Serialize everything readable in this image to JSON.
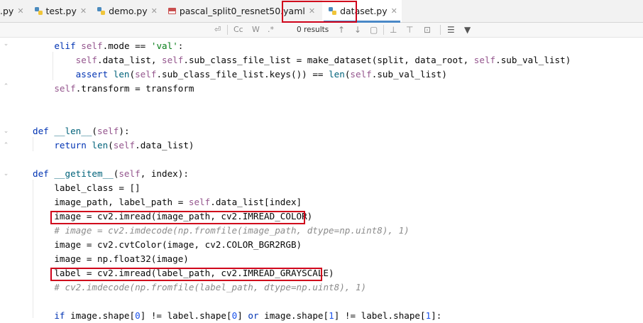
{
  "tabs": [
    {
      "label": ".py",
      "icon": "python-file-icon",
      "active": false
    },
    {
      "label": "test.py",
      "icon": "python-file-icon",
      "active": false
    },
    {
      "label": "demo.py",
      "icon": "python-file-icon",
      "active": false
    },
    {
      "label": "pascal_split0_resnet50.yaml",
      "icon": "yaml-file-icon",
      "active": false
    },
    {
      "label": "dataset.py",
      "icon": "python-file-icon",
      "active": true
    }
  ],
  "search": {
    "match_case": "Cc",
    "words": "W",
    "regex": ".*",
    "results": "0 results"
  },
  "code_lines": [
    "    elif self.mode == 'val':",
    "        self.data_list, self.sub_class_file_list = make_dataset(split, data_root, self.sub_val_list)",
    "        assert len(self.sub_class_file_list.keys()) == len(self.sub_val_list)",
    "    self.transform = transform",
    "",
    "",
    "def __len__(self):",
    "    return len(self.data_list)",
    "",
    "def __getitem__(self, index):",
    "    label_class = []",
    "    image_path, label_path = self.data_list[index]",
    "    image = cv2.imread(image_path, cv2.IMREAD_COLOR)",
    "    # image = cv2.imdecode(np.fromfile(image_path, dtype=np.uint8), 1)",
    "    image = cv2.cvtColor(image, cv2.COLOR_BGR2RGB)",
    "    image = np.float32(image)",
    "    label = cv2.imread(label_path, cv2.IMREAD_GRAYSCALE)",
    "    # cv2.imdecode(np.fromfile(label_path, dtype=np.uint8), 1)",
    "",
    "    if image.shape[0] != label.shape[0] or image.shape[1] != label.shape[1]:"
  ],
  "colors": {
    "keyword": "#0033b3",
    "self": "#94558d",
    "string": "#067d17",
    "function": "#00627a",
    "number": "#1750eb",
    "comment": "#8c8c8c",
    "highlight_box": "#d0021b"
  }
}
